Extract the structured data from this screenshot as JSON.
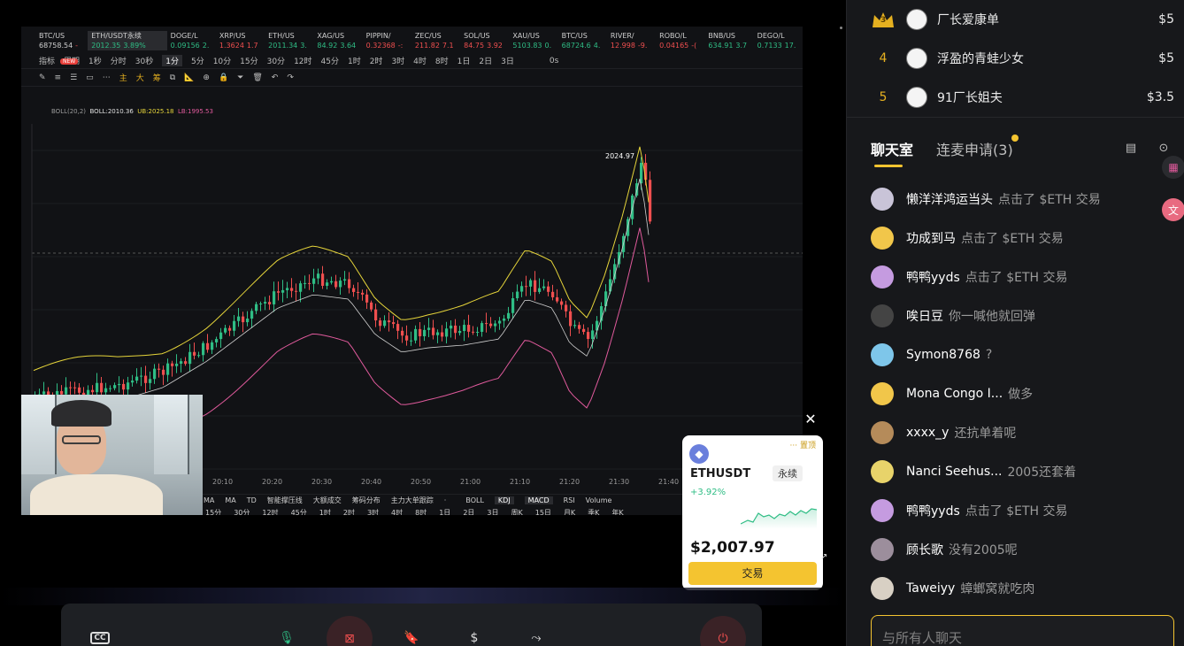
{
  "tickers": [
    {
      "name": "BTC/US",
      "price": "68758.54",
      "change": "-",
      "dir": "down"
    },
    {
      "name": "ETH/USDT永续",
      "price": "2012.35",
      "change": "3.89%",
      "dir": "up"
    },
    {
      "name": "DOGE/L",
      "price": "0.09156",
      "change": "2.",
      "dir": "up"
    },
    {
      "name": "XRP/US",
      "price": "1.3624",
      "change": "1.7",
      "dir": "down"
    },
    {
      "name": "ETH/US",
      "price": "2011.34",
      "change": "3.",
      "dir": "up"
    },
    {
      "name": "XAG/US",
      "price": "84.92",
      "change": "3.64",
      "dir": "up"
    },
    {
      "name": "PIPPIN/",
      "price": "0.32368",
      "change": "-:",
      "dir": "down"
    },
    {
      "name": "ZEC/US",
      "price": "211.82",
      "change": "7.1",
      "dir": "down"
    },
    {
      "name": "SOL/US",
      "price": "84.75",
      "change": "3.92",
      "dir": "down"
    },
    {
      "name": "XAU/US",
      "price": "5103.83",
      "change": "0.",
      "dir": "up"
    },
    {
      "name": "BTC/US",
      "price": "68724.6",
      "change": "4.",
      "dir": "up"
    },
    {
      "name": "RIVER/",
      "price": "12.998",
      "change": "-9.",
      "dir": "down"
    },
    {
      "name": "ROBO/L",
      "price": "0.04165",
      "change": "-(",
      "dir": "down"
    },
    {
      "name": "BNB/US",
      "price": "634.91",
      "change": "3.7",
      "dir": "up"
    },
    {
      "name": "DEGO/L",
      "price": "0.7133",
      "change": "17.",
      "dir": "up"
    }
  ],
  "new_badge": "NEW",
  "toolbar": {
    "indicator": "指标",
    "period": "周期",
    "intervals": [
      "1秒",
      "分时",
      "30秒",
      "1分",
      "5分",
      "10分",
      "15分",
      "30分",
      "12时",
      "45分",
      "1时",
      "2时",
      "3时",
      "4时",
      "8时",
      "1日",
      "2日",
      "3日"
    ],
    "selected_interval": "1分",
    "countdown": "0s"
  },
  "draw_tools": {
    "zhu": "主",
    "da": "大",
    "chou": "筹"
  },
  "boll": {
    "label": "BOLL(20,2)",
    "mid": "BOLL:2010.36",
    "ub": "UB:2025.18",
    "lb": "LB:1995.53"
  },
  "high_label": "2024.97",
  "time_axis": [
    "20:10",
    "20:20",
    "20:30",
    "20:40",
    "20:50",
    "21:00",
    "21:10",
    "21:20",
    "21:30",
    "21:40"
  ],
  "indicators_main": [
    "MA",
    "MA",
    "TD",
    "智能撑压线",
    "大额成交",
    "筹码分布",
    "主力大单跟踪",
    "·",
    "BOLL",
    "KDJ",
    "MACD",
    "RSI",
    "Volume"
  ],
  "indicators_sub": [
    "15分",
    "30分",
    "12时",
    "45分",
    "1时",
    "2时",
    "3时",
    "4时",
    "8时",
    "1日",
    "2日",
    "3日",
    "周K",
    "15日",
    "月K",
    "季K",
    "年K"
  ],
  "popup": {
    "pin": "置顶",
    "symbol": "ETHUSDT",
    "tag": "永续",
    "change": "+3.92%",
    "price": "$2,007.97",
    "trade": "交易"
  },
  "ranking": [
    {
      "rank": "3",
      "name": "厂长爱康单",
      "amount": "$5"
    },
    {
      "rank": "4",
      "name": "浮盈的青蛙少女",
      "amount": "$5"
    },
    {
      "rank": "5",
      "name": "91厂长姐夫",
      "amount": "$3.5"
    }
  ],
  "tabs": {
    "chat": "聊天室",
    "link": "连麦申请(3)"
  },
  "messages": [
    {
      "user": "懒洋洋鸿运当头",
      "text": "点击了 $ETH 交易",
      "color": "#c9c4d8"
    },
    {
      "user": "功成到马",
      "text": "点击了 $ETH 交易",
      "color": "#f1c64a"
    },
    {
      "user": "鸭鸭yyds",
      "text": "点击了 $ETH 交易",
      "color": "#c59be0"
    },
    {
      "user": "唉日豆",
      "text": "你一喊他就回弹",
      "color": "#444"
    },
    {
      "user": "Symon8768",
      "text": "?",
      "color": "#7ec6ea"
    },
    {
      "user": "Mona Congo I...",
      "text": "做多",
      "color": "#f1c64a"
    },
    {
      "user": "xxxx_y",
      "text": "还抗单着呢",
      "color": "#b58b5a"
    },
    {
      "user": "Nanci Seehus...",
      "text": "2005还套着",
      "color": "#e8d36a"
    },
    {
      "user": "鸭鸭yyds",
      "text": "点击了 $ETH 交易",
      "color": "#c59be0"
    },
    {
      "user": "顾长歌",
      "text": "没有2005呢",
      "color": "#9c8e9c"
    },
    {
      "user": "Taweiyy",
      "text": "蟑螂窝就吃肉",
      "color": "#d8d0c4"
    }
  ],
  "chat_placeholder": "与所有人聊天",
  "bottom_bar": {
    "cc": "CC"
  }
}
